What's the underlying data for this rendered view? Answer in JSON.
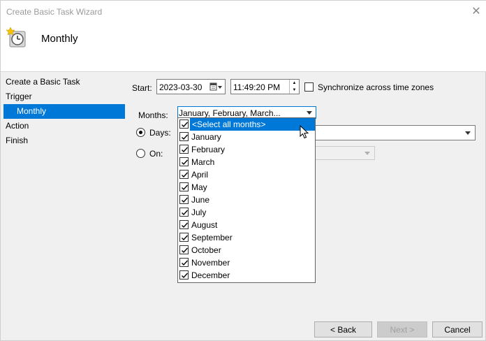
{
  "window": {
    "title": "Create Basic Task Wizard",
    "close_icon": "close-icon"
  },
  "header": {
    "title": "Monthly",
    "icon": "clock-icon"
  },
  "nav": {
    "items": [
      {
        "label": "Create a Basic Task"
      },
      {
        "label": "Trigger"
      },
      {
        "label": "Monthly"
      },
      {
        "label": "Action"
      },
      {
        "label": "Finish"
      }
    ]
  },
  "form": {
    "start_label": "Start:",
    "start_date": "2023-03-30",
    "start_time": "11:49:20 PM",
    "sync_label": "Synchronize across time zones",
    "months_label": "Months:",
    "months_value": "January, February, March...",
    "days_label": "Days:",
    "on_label": "On:"
  },
  "months_list": {
    "items": [
      "<Select all months>",
      "January",
      "February",
      "March",
      "April",
      "May",
      "June",
      "July",
      "August",
      "September",
      "October",
      "November",
      "December"
    ]
  },
  "buttons": {
    "back": "< Back",
    "next": "Next >",
    "cancel": "Cancel"
  },
  "colors": {
    "accent": "#0078d7"
  }
}
